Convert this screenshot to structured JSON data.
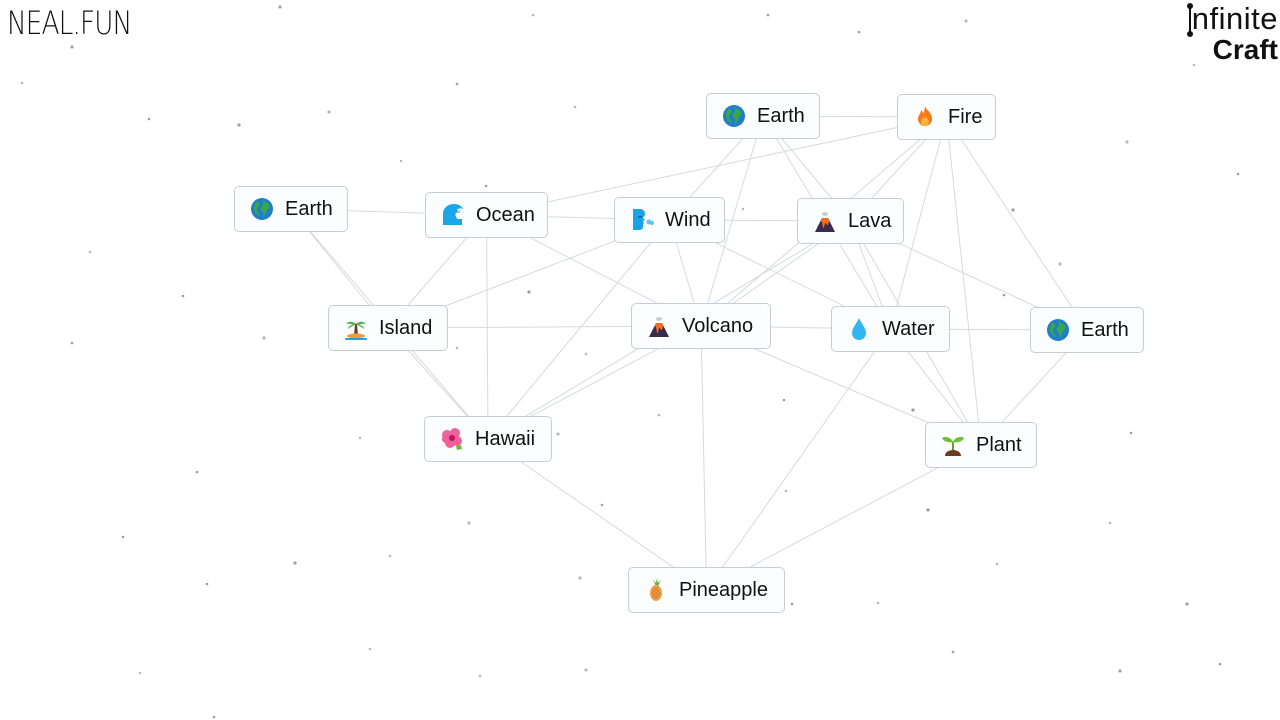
{
  "header": {
    "site_logo": "NEAL.FUN",
    "app_title_line1": "nfinite",
    "app_title_line2": "Craft"
  },
  "items": [
    {
      "id": "earth-top",
      "label": "Earth",
      "icon": "earth-globe-icon"
    },
    {
      "id": "fire",
      "label": "Fire",
      "icon": "fire-icon"
    },
    {
      "id": "earth-left",
      "label": "Earth",
      "icon": "earth-globe-icon"
    },
    {
      "id": "ocean",
      "label": "Ocean",
      "icon": "ocean-wave-icon"
    },
    {
      "id": "wind",
      "label": "Wind",
      "icon": "wind-face-icon"
    },
    {
      "id": "lava",
      "label": "Lava",
      "icon": "volcano-icon"
    },
    {
      "id": "island",
      "label": "Island",
      "icon": "desert-island-icon"
    },
    {
      "id": "volcano",
      "label": "Volcano",
      "icon": "volcano-icon"
    },
    {
      "id": "water",
      "label": "Water",
      "icon": "water-droplet-icon"
    },
    {
      "id": "earth-right",
      "label": "Earth",
      "icon": "earth-globe-icon"
    },
    {
      "id": "hawaii",
      "label": "Hawaii",
      "icon": "hibiscus-icon"
    },
    {
      "id": "plant",
      "label": "Plant",
      "icon": "seedling-icon"
    },
    {
      "id": "pineapple",
      "label": "Pineapple",
      "icon": "pineapple-icon"
    }
  ],
  "connections": [
    [
      "earth-top",
      "fire"
    ],
    [
      "earth-top",
      "wind"
    ],
    [
      "earth-top",
      "volcano"
    ],
    [
      "earth-top",
      "lava"
    ],
    [
      "earth-top",
      "water"
    ],
    [
      "fire",
      "lava"
    ],
    [
      "fire",
      "water"
    ],
    [
      "fire",
      "plant"
    ],
    [
      "fire",
      "earth-right"
    ],
    [
      "fire",
      "ocean"
    ],
    [
      "fire",
      "volcano"
    ],
    [
      "earth-left",
      "ocean"
    ],
    [
      "earth-left",
      "island"
    ],
    [
      "earth-left",
      "hawaii"
    ],
    [
      "ocean",
      "wind"
    ],
    [
      "ocean",
      "island"
    ],
    [
      "ocean",
      "hawaii"
    ],
    [
      "ocean",
      "volcano"
    ],
    [
      "wind",
      "lava"
    ],
    [
      "wind",
      "volcano"
    ],
    [
      "wind",
      "water"
    ],
    [
      "wind",
      "island"
    ],
    [
      "wind",
      "hawaii"
    ],
    [
      "lava",
      "volcano"
    ],
    [
      "lava",
      "water"
    ],
    [
      "lava",
      "plant"
    ],
    [
      "lava",
      "earth-right"
    ],
    [
      "lava",
      "hawaii"
    ],
    [
      "island",
      "volcano"
    ],
    [
      "island",
      "hawaii"
    ],
    [
      "volcano",
      "water"
    ],
    [
      "volcano",
      "pineapple"
    ],
    [
      "volcano",
      "plant"
    ],
    [
      "volcano",
      "hawaii"
    ],
    [
      "water",
      "earth-right"
    ],
    [
      "water",
      "plant"
    ],
    [
      "water",
      "pineapple"
    ],
    [
      "earth-right",
      "plant"
    ],
    [
      "hawaii",
      "pineapple"
    ],
    [
      "plant",
      "pineapple"
    ]
  ]
}
